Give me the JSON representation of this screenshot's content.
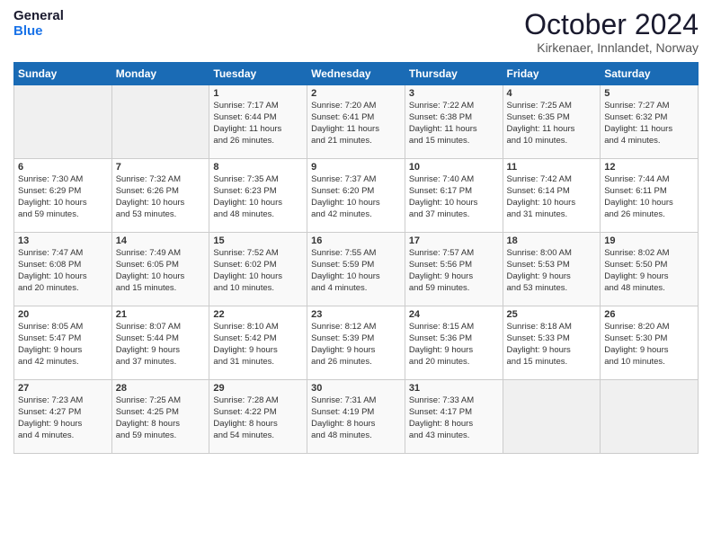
{
  "header": {
    "logo_line1": "General",
    "logo_line2": "Blue",
    "month": "October 2024",
    "location": "Kirkenaer, Innlandet, Norway"
  },
  "days_of_week": [
    "Sunday",
    "Monday",
    "Tuesday",
    "Wednesday",
    "Thursday",
    "Friday",
    "Saturday"
  ],
  "weeks": [
    [
      {
        "day": "",
        "info": ""
      },
      {
        "day": "",
        "info": ""
      },
      {
        "day": "1",
        "info": "Sunrise: 7:17 AM\nSunset: 6:44 PM\nDaylight: 11 hours\nand 26 minutes."
      },
      {
        "day": "2",
        "info": "Sunrise: 7:20 AM\nSunset: 6:41 PM\nDaylight: 11 hours\nand 21 minutes."
      },
      {
        "day": "3",
        "info": "Sunrise: 7:22 AM\nSunset: 6:38 PM\nDaylight: 11 hours\nand 15 minutes."
      },
      {
        "day": "4",
        "info": "Sunrise: 7:25 AM\nSunset: 6:35 PM\nDaylight: 11 hours\nand 10 minutes."
      },
      {
        "day": "5",
        "info": "Sunrise: 7:27 AM\nSunset: 6:32 PM\nDaylight: 11 hours\nand 4 minutes."
      }
    ],
    [
      {
        "day": "6",
        "info": "Sunrise: 7:30 AM\nSunset: 6:29 PM\nDaylight: 10 hours\nand 59 minutes."
      },
      {
        "day": "7",
        "info": "Sunrise: 7:32 AM\nSunset: 6:26 PM\nDaylight: 10 hours\nand 53 minutes."
      },
      {
        "day": "8",
        "info": "Sunrise: 7:35 AM\nSunset: 6:23 PM\nDaylight: 10 hours\nand 48 minutes."
      },
      {
        "day": "9",
        "info": "Sunrise: 7:37 AM\nSunset: 6:20 PM\nDaylight: 10 hours\nand 42 minutes."
      },
      {
        "day": "10",
        "info": "Sunrise: 7:40 AM\nSunset: 6:17 PM\nDaylight: 10 hours\nand 37 minutes."
      },
      {
        "day": "11",
        "info": "Sunrise: 7:42 AM\nSunset: 6:14 PM\nDaylight: 10 hours\nand 31 minutes."
      },
      {
        "day": "12",
        "info": "Sunrise: 7:44 AM\nSunset: 6:11 PM\nDaylight: 10 hours\nand 26 minutes."
      }
    ],
    [
      {
        "day": "13",
        "info": "Sunrise: 7:47 AM\nSunset: 6:08 PM\nDaylight: 10 hours\nand 20 minutes."
      },
      {
        "day": "14",
        "info": "Sunrise: 7:49 AM\nSunset: 6:05 PM\nDaylight: 10 hours\nand 15 minutes."
      },
      {
        "day": "15",
        "info": "Sunrise: 7:52 AM\nSunset: 6:02 PM\nDaylight: 10 hours\nand 10 minutes."
      },
      {
        "day": "16",
        "info": "Sunrise: 7:55 AM\nSunset: 5:59 PM\nDaylight: 10 hours\nand 4 minutes."
      },
      {
        "day": "17",
        "info": "Sunrise: 7:57 AM\nSunset: 5:56 PM\nDaylight: 9 hours\nand 59 minutes."
      },
      {
        "day": "18",
        "info": "Sunrise: 8:00 AM\nSunset: 5:53 PM\nDaylight: 9 hours\nand 53 minutes."
      },
      {
        "day": "19",
        "info": "Sunrise: 8:02 AM\nSunset: 5:50 PM\nDaylight: 9 hours\nand 48 minutes."
      }
    ],
    [
      {
        "day": "20",
        "info": "Sunrise: 8:05 AM\nSunset: 5:47 PM\nDaylight: 9 hours\nand 42 minutes."
      },
      {
        "day": "21",
        "info": "Sunrise: 8:07 AM\nSunset: 5:44 PM\nDaylight: 9 hours\nand 37 minutes."
      },
      {
        "day": "22",
        "info": "Sunrise: 8:10 AM\nSunset: 5:42 PM\nDaylight: 9 hours\nand 31 minutes."
      },
      {
        "day": "23",
        "info": "Sunrise: 8:12 AM\nSunset: 5:39 PM\nDaylight: 9 hours\nand 26 minutes."
      },
      {
        "day": "24",
        "info": "Sunrise: 8:15 AM\nSunset: 5:36 PM\nDaylight: 9 hours\nand 20 minutes."
      },
      {
        "day": "25",
        "info": "Sunrise: 8:18 AM\nSunset: 5:33 PM\nDaylight: 9 hours\nand 15 minutes."
      },
      {
        "day": "26",
        "info": "Sunrise: 8:20 AM\nSunset: 5:30 PM\nDaylight: 9 hours\nand 10 minutes."
      }
    ],
    [
      {
        "day": "27",
        "info": "Sunrise: 7:23 AM\nSunset: 4:27 PM\nDaylight: 9 hours\nand 4 minutes."
      },
      {
        "day": "28",
        "info": "Sunrise: 7:25 AM\nSunset: 4:25 PM\nDaylight: 8 hours\nand 59 minutes."
      },
      {
        "day": "29",
        "info": "Sunrise: 7:28 AM\nSunset: 4:22 PM\nDaylight: 8 hours\nand 54 minutes."
      },
      {
        "day": "30",
        "info": "Sunrise: 7:31 AM\nSunset: 4:19 PM\nDaylight: 8 hours\nand 48 minutes."
      },
      {
        "day": "31",
        "info": "Sunrise: 7:33 AM\nSunset: 4:17 PM\nDaylight: 8 hours\nand 43 minutes."
      },
      {
        "day": "",
        "info": ""
      },
      {
        "day": "",
        "info": ""
      }
    ]
  ]
}
